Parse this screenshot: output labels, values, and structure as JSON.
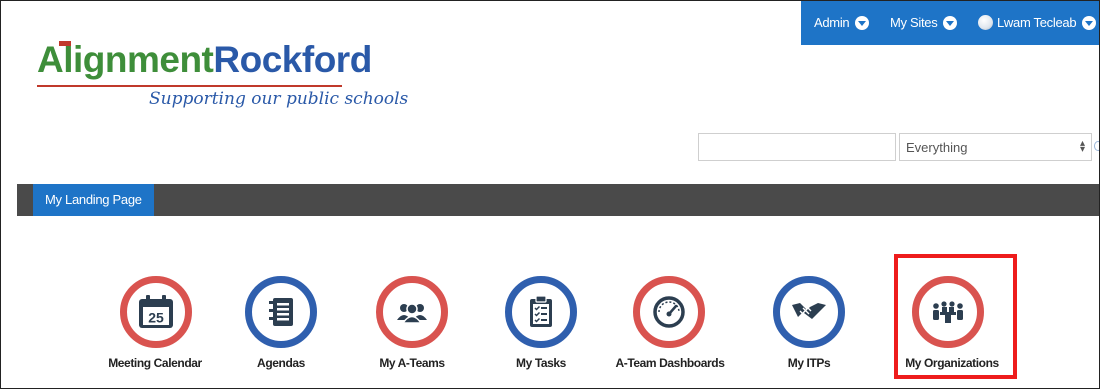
{
  "topbar": {
    "admin_label": "Admin",
    "sites_label": "My Sites",
    "user_name": "Lwam Tecleab"
  },
  "logo": {
    "name_part1": "Alignment",
    "name_part2": "Rockford",
    "tagline": "Supporting our public schools"
  },
  "search": {
    "query": "",
    "scope_value": "Everything"
  },
  "nav": {
    "tabs": [
      {
        "label": "My Landing Page",
        "active": true
      }
    ]
  },
  "tiles": [
    {
      "label": "Meeting Calendar",
      "ring": "red",
      "icon": "calendar-icon",
      "day": "25"
    },
    {
      "label": "Agendas",
      "ring": "blue",
      "icon": "notebook-icon"
    },
    {
      "label": "My A-Teams",
      "ring": "red",
      "icon": "group-icon"
    },
    {
      "label": "My Tasks",
      "ring": "blue",
      "icon": "clipboard-checklist-icon"
    },
    {
      "label": "A-Team Dashboards",
      "ring": "red",
      "icon": "speedometer-icon"
    },
    {
      "label": "My ITPs",
      "ring": "blue",
      "icon": "handshake-icon"
    },
    {
      "label": "My Organizations",
      "ring": "red",
      "icon": "meeting-table-icon",
      "highlighted": true
    }
  ],
  "colors": {
    "brand_blue": "#1e74c7",
    "nav_gray": "#4a4a4a",
    "ring_red": "#d9534f",
    "ring_blue": "#2f5fae",
    "logo_green": "#3e8e3a",
    "logo_blue": "#2a59a8",
    "highlight_red": "#ee1c1c"
  }
}
